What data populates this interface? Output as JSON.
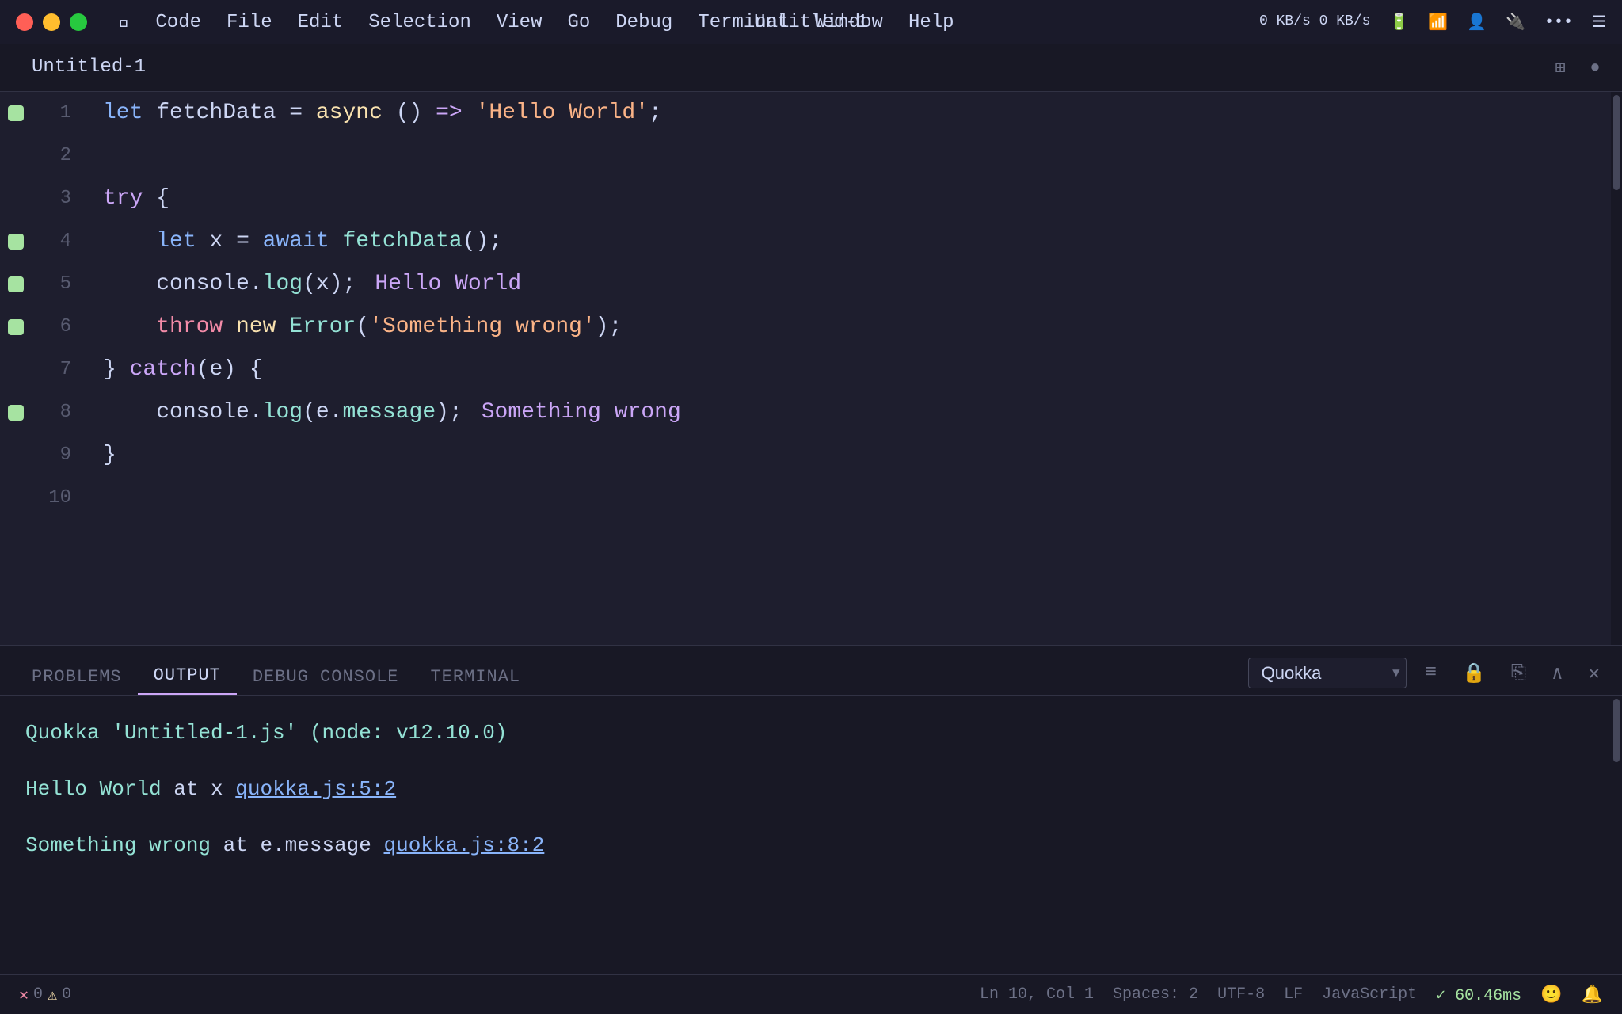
{
  "titlebar": {
    "title": "Untitled-1",
    "menu_items": [
      "Code",
      "File",
      "Edit",
      "Selection",
      "View",
      "Go",
      "Debug",
      "Terminal",
      "Window",
      "Help"
    ],
    "kb_label": "0 KB/s\n0 KB/s"
  },
  "editor": {
    "tab_label": "Untitled-1",
    "lines": [
      {
        "num": 1,
        "has_bp": true,
        "content": "line1"
      },
      {
        "num": 2,
        "has_bp": false,
        "content": "empty"
      },
      {
        "num": 3,
        "has_bp": false,
        "content": "line3"
      },
      {
        "num": 4,
        "has_bp": true,
        "content": "line4"
      },
      {
        "num": 5,
        "has_bp": true,
        "content": "line5"
      },
      {
        "num": 6,
        "has_bp": true,
        "content": "line6"
      },
      {
        "num": 7,
        "has_bp": false,
        "content": "line7"
      },
      {
        "num": 8,
        "has_bp": true,
        "content": "line8"
      },
      {
        "num": 9,
        "has_bp": false,
        "content": "line9"
      },
      {
        "num": 10,
        "has_bp": false,
        "content": "empty"
      }
    ]
  },
  "panel": {
    "tabs": [
      "PROBLEMS",
      "OUTPUT",
      "DEBUG CONSOLE",
      "TERMINAL"
    ],
    "active_tab": "OUTPUT",
    "select_value": "Quokka",
    "output_line1": "Quokka 'Untitled-1.js' (node: v12.10.0)",
    "output_line2_prefix": "Hello World",
    "output_line2_mid": " at x ",
    "output_line2_link": "quokka.js:5:2",
    "output_line3_prefix": "Something wrong",
    "output_line3_mid": " at e.message ",
    "output_line3_link": "quokka.js:8:2"
  },
  "statusbar": {
    "error_count": "0",
    "warn_count": "0",
    "position": "Ln 10, Col 1",
    "spaces": "Spaces: 2",
    "encoding": "UTF-8",
    "line_ending": "LF",
    "language": "JavaScript",
    "timing": "✓ 60.46ms"
  },
  "code": {
    "line1": "let fetchData = async () => 'Hello World';",
    "line3": "try {",
    "line4": "    let x = await fetchData();",
    "line5": "    console.log(x);    Hello World",
    "line6": "    throw new Error('Something wrong');",
    "line7": "} catch(e) {",
    "line8": "    console.log(e.message);    Something wrong",
    "line9": "}"
  }
}
